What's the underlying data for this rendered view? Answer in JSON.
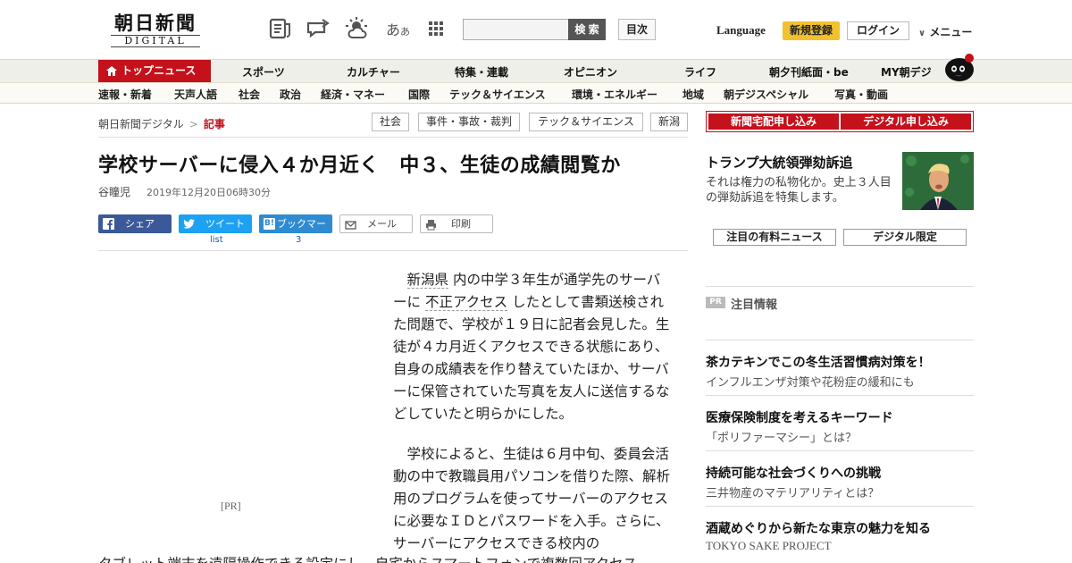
{
  "header": {
    "logo_jp": "朝日新聞",
    "logo_en": "DIGITAL",
    "icons": [
      "news-icon",
      "comment-icon",
      "weather-icon",
      "font-size-icon",
      "apps-grid-icon"
    ],
    "font_icon_text": "あ",
    "font_icon_text_small": "あ",
    "search_placeholder": "",
    "search_button": "検 索",
    "toc_button": "目次",
    "language": "Language",
    "register": "新規登録",
    "login": "ログイン",
    "menu": "メニュー",
    "menu_chevron": "∨"
  },
  "nav_primary": {
    "top": "トップニュース",
    "items": [
      "スポーツ",
      "カルチャー",
      "特集・連載",
      "オピニオン",
      "ライフ",
      "朝夕刊紙面・be",
      "MY朝デジ"
    ]
  },
  "nav_secondary": {
    "items": [
      "速報・新着",
      "天声人語",
      "社会",
      "政治",
      "経済・マネー",
      "国際",
      "テック＆サイエンス",
      "環境・エネルギー",
      "地域",
      "朝デジスペシャル",
      "写真・動画"
    ]
  },
  "breadcrumb": {
    "root": "朝日新聞デジタル",
    "sep": ">",
    "current": "記事"
  },
  "tags": [
    "社会",
    "事件・事故・裁判",
    "テック＆サイエンス",
    "新潟"
  ],
  "article": {
    "headline": "学校サーバーに侵入４か月近く　中３、生徒の成績閲覧か",
    "author": "谷瞳児",
    "date": "2019年12月20日06時30分",
    "share": {
      "facebook": "シェア",
      "twitter": "ツイート",
      "twitter_count": "list",
      "hatena": "ブックマーク",
      "hatena_count": "3",
      "mail": "メール",
      "print": "印刷"
    },
    "pr_label": "[PR]",
    "p1_link1": "新潟県",
    "p1_a": "内の中学３年生が通学先のサーバーに",
    "p1_link2": "不正アクセス",
    "p1_b": "したとして書類送検された問題で、学校が１９日に記者会見した。生徒が４カ月近くアクセスできる状態にあり、自身の成績表を作り替えていたほか、サーバーに保管されていた写真を友人に送信するなどしていたと明らかにした。",
    "p2": "学校によると、生徒は６月中旬、委員会活動の中で教職員用パソコンを借りた際、解析用のプログラムを使ってサーバーのアクセスに必要なＩＤとパスワードを入手。さらに、サーバーにアクセスできる校内の",
    "p2_overflow": "タブレット端末を遠隔操作できる設定にし、自宅からスマートフォンで複数回アクセス"
  },
  "sidebar": {
    "sub_home": "新聞宅配申し込み",
    "sub_digital": "デジタル申し込み",
    "feature_title": "トランプ大統領弾劾訴追",
    "feature_desc": "それは権力の私物化か。史上３人目の弾劾訴追を特集します。",
    "btn_paid": "注目の有料ニュース",
    "btn_digital": "デジタル限定",
    "pr_badge": "PR",
    "pr_heading": "注目情報",
    "pr_items": [
      {
        "title": "茶カテキンでこの冬生活習慣病対策を！",
        "sub": "インフルエンザ対策や花粉症の緩和にも"
      },
      {
        "title": "医療保険制度を考えるキーワード",
        "sub": "「ポリファーマシー」とは？"
      },
      {
        "title": "持続可能な社会づくりへの挑戦",
        "sub": "三井物産のマテリアリティとは？"
      },
      {
        "title": "酒蔵めぐりから新たな東京の魅力を知る",
        "sub": "TOKYO SAKE PROJECT"
      }
    ]
  },
  "colors": {
    "brand_red": "#c4111b",
    "register_yellow": "#f2c12e",
    "link_blue": "#1a5ea8",
    "facebook": "#3b5998",
    "twitter": "#1da1f2",
    "hatena": "#2f8bd1"
  }
}
